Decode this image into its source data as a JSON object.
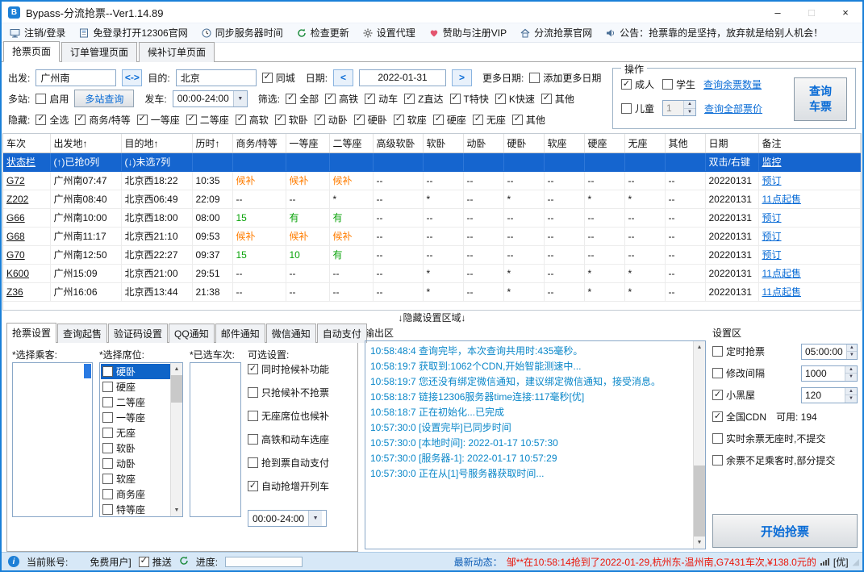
{
  "window": {
    "title": "Bypass-分流抢票--Ver1.14.89"
  },
  "titlebar_buttons": [
    {
      "icon": "minimize-icon",
      "glyph": "–",
      "dim": false
    },
    {
      "icon": "maximize-icon",
      "glyph": "□",
      "dim": true
    },
    {
      "icon": "close-icon",
      "glyph": "×",
      "dim": false
    }
  ],
  "toolbar": {
    "items": [
      {
        "icon": "login-monitor-icon",
        "label": "注销/登录"
      },
      {
        "icon": "website-12306-icon",
        "label": "免登录打开12306官网"
      },
      {
        "icon": "clock-icon",
        "label": "同步服务器时间"
      },
      {
        "icon": "refresh-icon",
        "label": "检查更新"
      },
      {
        "icon": "proxy-gear-icon",
        "label": "设置代理"
      },
      {
        "icon": "vip-heart-icon",
        "label": "赞助与注册VIP"
      },
      {
        "icon": "home-icon",
        "label": "分流抢票官网"
      },
      {
        "icon": "announcement-speaker-icon",
        "label": "公告：抢票靠的是坚持，放弃就是给别人机会！"
      }
    ]
  },
  "main_tabs": {
    "active": 0,
    "items": [
      "抢票页面",
      "订单管理页面",
      "候补订单页面"
    ]
  },
  "query": {
    "depart_label": "出发:",
    "depart_value": "广州南",
    "swap_button": "<->",
    "dest_label": "目的:",
    "dest_value": "北京",
    "same_city": {
      "label": "同城",
      "checked": true
    },
    "date_label": "日期:",
    "date_value": "2022-01-31",
    "more_dates_label": "更多日期:",
    "add_more_dates": {
      "label": "添加更多日期",
      "checked": false
    },
    "multi_station_label": "多站:",
    "multi_enable": {
      "label": "启用",
      "checked": false
    },
    "multi_query_button": "多站查询",
    "depart_time_label": "发车:",
    "depart_time_value": "00:00-24:00",
    "filter_label": "筛选:",
    "filters": [
      {
        "label": "全部",
        "checked": true
      },
      {
        "label": "高铁",
        "checked": true
      },
      {
        "label": "动车",
        "checked": true
      },
      {
        "label": "Z直达",
        "checked": true
      },
      {
        "label": "T特快",
        "checked": true
      },
      {
        "label": "K快速",
        "checked": true
      },
      {
        "label": "其他",
        "checked": true
      }
    ],
    "hide_label": "隐藏:",
    "hides": [
      {
        "label": "全选",
        "checked": true
      },
      {
        "label": "商务/特等",
        "checked": true
      },
      {
        "label": "一等座",
        "checked": true
      },
      {
        "label": "二等座",
        "checked": true
      },
      {
        "label": "高软",
        "checked": true
      },
      {
        "label": "软卧",
        "checked": true
      },
      {
        "label": "动卧",
        "checked": true
      },
      {
        "label": "硬卧",
        "checked": true
      },
      {
        "label": "软座",
        "checked": true
      },
      {
        "label": "硬座",
        "checked": true
      },
      {
        "label": "无座",
        "checked": true
      },
      {
        "label": "其他",
        "checked": true
      }
    ]
  },
  "operation": {
    "title": "操作",
    "adult": {
      "label": "成人",
      "checked": true
    },
    "student": {
      "label": "学生",
      "checked": false
    },
    "child": {
      "label": "儿童",
      "checked": false
    },
    "child_count": "1",
    "query_remaining_link": "查询余票数量",
    "query_price_link": "查询全部票价",
    "query_button": "查询车票"
  },
  "train_table": {
    "columns": [
      "车次",
      "出发地↑",
      "目的地↑",
      "历时↑",
      "商务/特等",
      "一等座",
      "二等座",
      "高级软卧",
      "软卧",
      "动卧",
      "硬卧",
      "软座",
      "硬座",
      "无座",
      "其他",
      "日期",
      "备注"
    ],
    "status_row": [
      "状态栏",
      "(↑)已抢0列",
      "(↓)未选7列",
      "",
      "",
      "",
      "",
      "",
      "",
      "",
      "",
      "",
      "",
      "",
      "",
      "双击/右键",
      "监控"
    ],
    "rows": [
      [
        "G72",
        "广州南07:47",
        "北京西18:22",
        "10:35",
        "候补",
        "候补",
        "候补",
        "--",
        "--",
        "--",
        "--",
        "--",
        "--",
        "--",
        "--",
        "20220131",
        "预订"
      ],
      [
        "Z202",
        "广州南08:40",
        "北京西06:49",
        "22:09",
        "--",
        "--",
        "*",
        "--",
        "*",
        "--",
        "*",
        "--",
        "*",
        "*",
        "--",
        "20220131",
        "11点起售"
      ],
      [
        "G66",
        "广州南10:00",
        "北京西18:00",
        "08:00",
        "15",
        "有",
        "有",
        "--",
        "--",
        "--",
        "--",
        "--",
        "--",
        "--",
        "--",
        "20220131",
        "预订"
      ],
      [
        "G68",
        "广州南11:17",
        "北京西21:10",
        "09:53",
        "候补",
        "候补",
        "候补",
        "--",
        "--",
        "--",
        "--",
        "--",
        "--",
        "--",
        "--",
        "20220131",
        "预订"
      ],
      [
        "G70",
        "广州南12:50",
        "北京西22:27",
        "09:37",
        "15",
        "10",
        "有",
        "--",
        "--",
        "--",
        "--",
        "--",
        "--",
        "--",
        "--",
        "20220131",
        "预订"
      ],
      [
        "K600",
        "广州15:09",
        "北京西21:00",
        "29:51",
        "--",
        "--",
        "--",
        "--",
        "*",
        "--",
        "*",
        "--",
        "*",
        "*",
        "--",
        "20220131",
        "11点起售"
      ],
      [
        "Z36",
        "广州16:06",
        "北京西13:44",
        "21:38",
        "--",
        "--",
        "--",
        "--",
        "*",
        "--",
        "*",
        "--",
        "*",
        "*",
        "--",
        "20220131",
        "11点起售"
      ]
    ]
  },
  "hidden_divider": "↓隐藏设置区域↓",
  "bottom_tabs": {
    "active": 0,
    "items": [
      "抢票设置",
      "查询起售",
      "验证码设置",
      "QQ通知",
      "邮件通知",
      "微信通知",
      "自动支付"
    ]
  },
  "grab_settings": {
    "passengers_label": "*选择乘客:",
    "seats_label": "*选择席位:",
    "trains_label": "*已选车次:",
    "optional_label": "可选设置:",
    "seat_options": [
      {
        "label": "硬卧",
        "checked": false,
        "selected": true
      },
      {
        "label": "硬座",
        "checked": false,
        "selected": false
      },
      {
        "label": "二等座",
        "checked": false,
        "selected": false
      },
      {
        "label": "一等座",
        "checked": false,
        "selected": false
      },
      {
        "label": "无座",
        "checked": false,
        "selected": false
      },
      {
        "label": "软卧",
        "checked": false,
        "selected": false
      },
      {
        "label": "动卧",
        "checked": false,
        "selected": false
      },
      {
        "label": "软座",
        "checked": false,
        "selected": false
      },
      {
        "label": "商务座",
        "checked": false,
        "selected": false
      },
      {
        "label": "特等座",
        "checked": false,
        "selected": false
      }
    ],
    "optional_settings": [
      {
        "label": "同时抢候补功能",
        "checked": true
      },
      {
        "label": "只抢候补不抢票",
        "checked": false
      },
      {
        "label": "无座席位也候补",
        "checked": false
      },
      {
        "label": "高铁和动车选座",
        "checked": false
      },
      {
        "label": "抢到票自动支付",
        "checked": false
      },
      {
        "label": "自动抢增开列车",
        "checked": true
      }
    ],
    "time_range_value": "00:00-24:00"
  },
  "output": {
    "title": "输出区",
    "lines": [
      "10:58:48:4  查询完毕，本次查询共用时:435毫秒。",
      "10:58:19:7  获取到:1062个CDN,开始智能测速中...",
      "10:58:19:7  您还没有绑定微信通知，建议绑定微信通知，接受消息。",
      "10:58:18:7  链接12306服务器time连接:117毫秒[优]",
      "10:58:18:7  正在初始化...已完成",
      "10:57:30:0  [设置完毕]已同步时间",
      "10:57:30:0  [本地时间]: 2022-01-17 10:57:30",
      "10:57:30:0  [服务器-1]:  2022-01-17 10:57:29",
      "10:57:30:0  正在从[1]号服务器获取时间..."
    ]
  },
  "settings_area": {
    "title": "设置区",
    "rows": [
      {
        "label": "定时抢票",
        "checked": false,
        "value": "05:00:00"
      },
      {
        "label": "修改间隔",
        "checked": false,
        "value": "1000"
      },
      {
        "label": "小黑屋",
        "checked": true,
        "value": "120"
      },
      {
        "label": "全国CDN",
        "checked": true,
        "text": "可用: 194"
      },
      {
        "label": "实时余票无座时,不提交",
        "checked": false
      },
      {
        "label": "余票不足乘客时,部分提交",
        "checked": false
      }
    ],
    "start_button": "开始抢票"
  },
  "statusbar": {
    "account_label": "当前账号:",
    "account_value": "免费用户]",
    "push": {
      "label": "推送",
      "checked": true
    },
    "progress_label": "进度:",
    "news_label": "最新动态：",
    "news_text": "邹**在10:58:14抢到了2022-01-29,杭州东-温州南,G7431车次,¥138.0元的",
    "signal_label": "[优]"
  }
}
